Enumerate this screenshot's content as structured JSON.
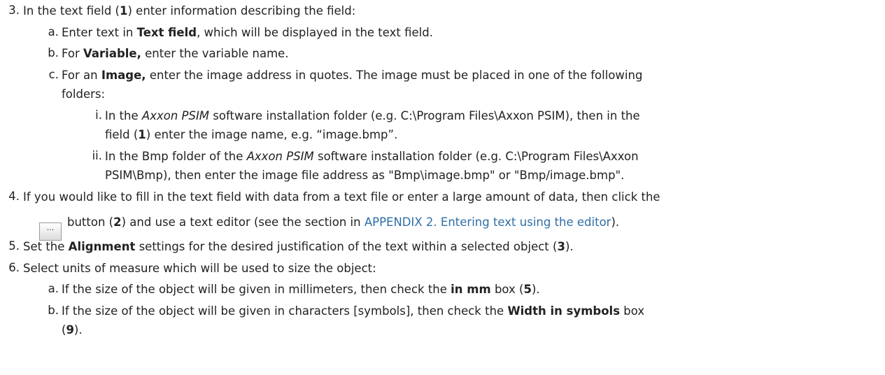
{
  "colors": {
    "text": "#222222",
    "link": "#2e6ea6"
  },
  "items": {
    "s3": {
      "num": "3.",
      "t1": "In the text field (",
      "b1": "1",
      "t2": ") enter information describing the field:",
      "a": {
        "num": "a.",
        "t1": "Enter text in ",
        "b1": "Text field",
        "t2": ", which will be displayed in the text field."
      },
      "b": {
        "num": "b.",
        "t1": "For ",
        "b1": "Variable,",
        "t2": " enter the variable name."
      },
      "c": {
        "num": "c.",
        "t1": "For an ",
        "b1": "Image,",
        "t2": " enter the image address in quotes. The image must be placed in one of the following",
        "l2": "folders:",
        "i": {
          "num": "i.",
          "t1": "In the ",
          "it1": "Axxon PSIM",
          "t2": " software installation folder (e.g. C:\\Program Files\\Axxon PSIM), then in the",
          "l2a": "field (",
          "l2b": "1",
          "l2c": ") enter the image name, e.g. “image.bmp”."
        },
        "ii": {
          "num": "ii.",
          "t1": "In the Bmp folder of the ",
          "it1": "Axxon PSIM",
          "t2": " software installation folder (e.g. C:\\Program Files\\Axxon",
          "l2": "PSIM\\Bmp), then enter the image file address as \"Bmp\\image.bmp\" or \"Bmp/image.bmp\"."
        }
      }
    },
    "s4": {
      "num": "4.",
      "t1": "If you would like to fill in the text field with data from a text file or enter a large amount of data, then click the",
      "button_label": "...",
      "l2a": "button (",
      "l2b": "2",
      "l2c": ") and use a text editor (see the section in ",
      "link": "APPENDIX 2. Entering text using the editor",
      "l2d": ")."
    },
    "s5": {
      "num": "5.",
      "t1": "Set the ",
      "b1": "Alignment",
      "t2": " settings for the desired justification of the text within a selected object (",
      "b2": "3",
      "t3": ")."
    },
    "s6": {
      "num": "6.",
      "t1": "Select units of measure which will be used to size the object:",
      "a": {
        "num": "a.",
        "t1": "If the size of the object will be given in millimeters, then check the ",
        "b1": "in mm",
        "t2": " box (",
        "b2": "5",
        "t3": ")."
      },
      "b": {
        "num": "b.",
        "t1": "If the size of the object will be given in characters [symbols], then check the ",
        "b1": "Width in symbols",
        "t2": " box",
        "l2a": "(",
        "l2b": "9",
        "l2c": ")."
      }
    }
  }
}
